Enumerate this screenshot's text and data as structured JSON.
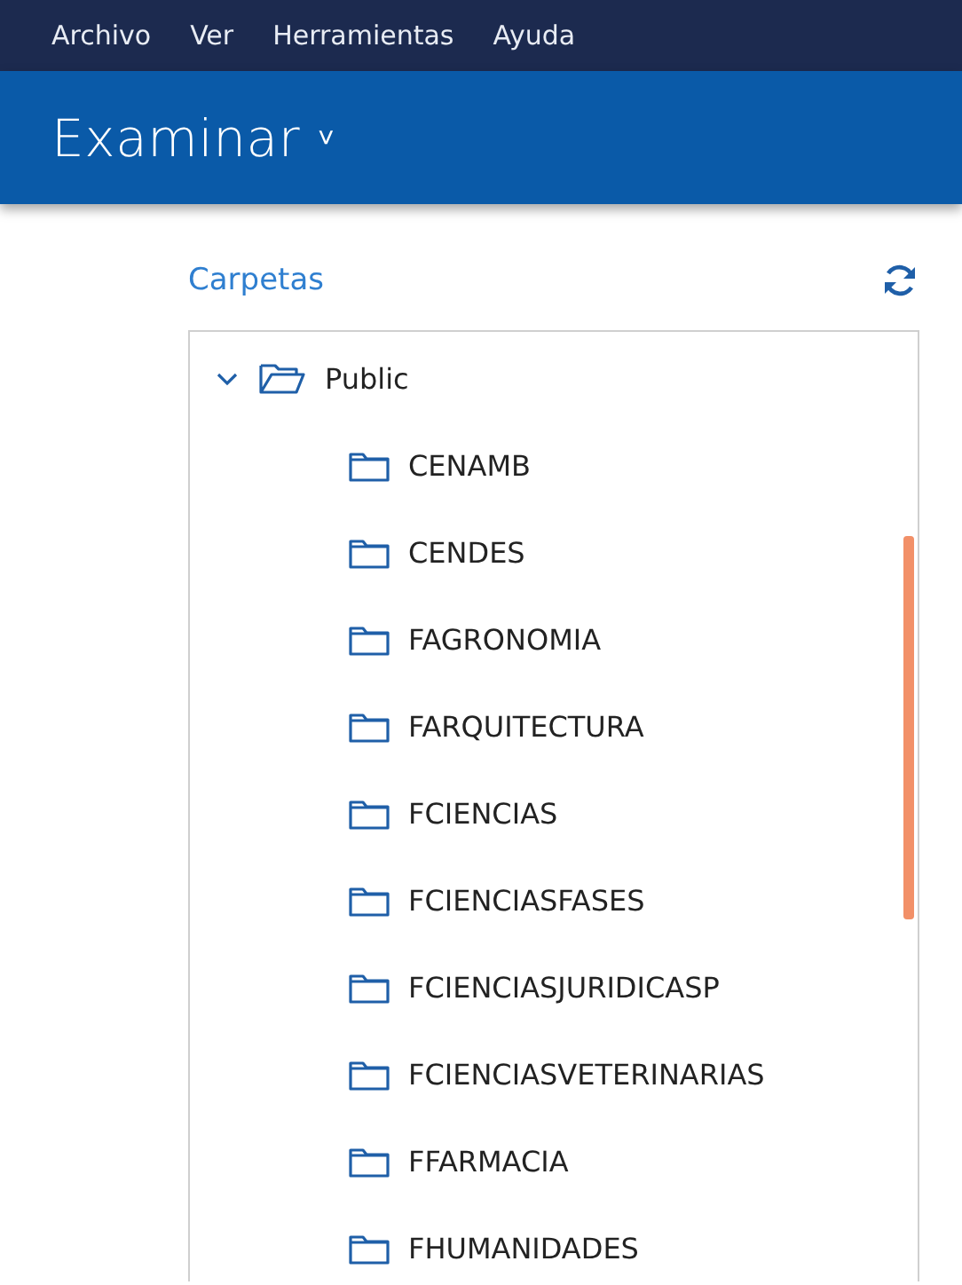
{
  "menu": [
    "Archivo",
    "Ver",
    "Herramientas",
    "Ayuda"
  ],
  "header": {
    "title": "Examinar",
    "dropdown_icon": "˅"
  },
  "folders_panel": {
    "label": "Carpetas",
    "tree": [
      {
        "label": "Public",
        "expanded": true,
        "children": [
          {
            "label": "CENAMB"
          },
          {
            "label": "CENDES"
          },
          {
            "label": "FAGRONOMIA"
          },
          {
            "label": "FARQUITECTURA"
          },
          {
            "label": "FCIENCIAS"
          },
          {
            "label": "FCIENCIASFASES"
          },
          {
            "label": "FCIENCIASJURIDICASP"
          },
          {
            "label": "FCIENCIASVETERINARIAS"
          },
          {
            "label": "FFARMACIA"
          },
          {
            "label": "FHUMANIDADES"
          }
        ]
      }
    ]
  }
}
